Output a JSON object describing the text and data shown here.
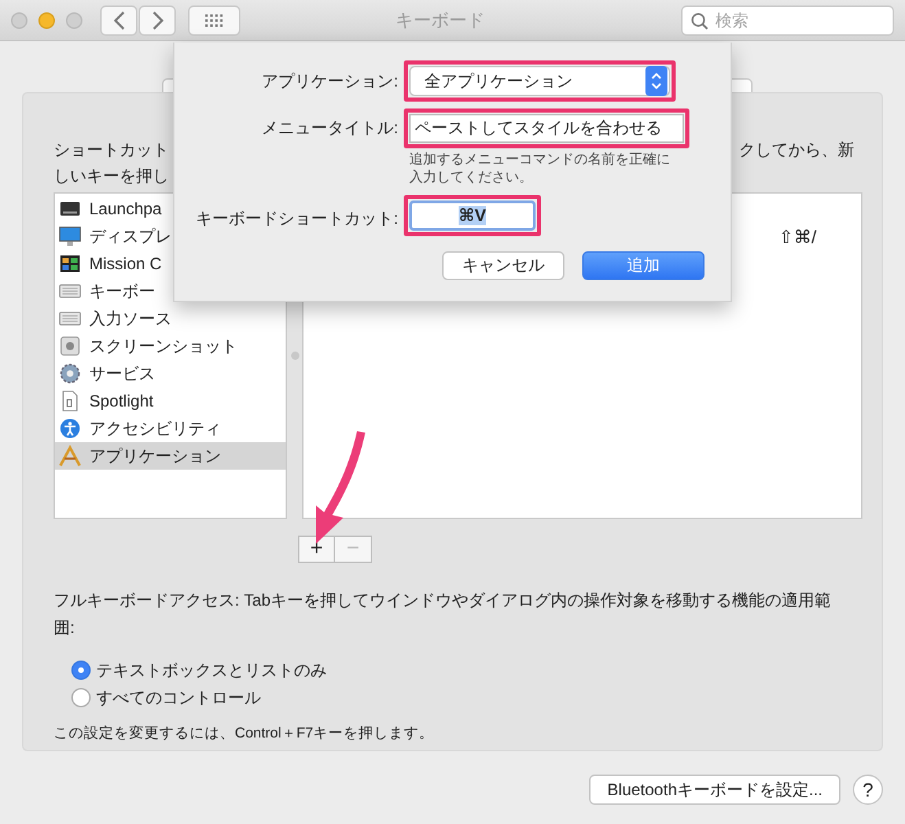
{
  "window": {
    "title": "キーボード"
  },
  "search": {
    "placeholder": "検索"
  },
  "shortcut_hint": [
    "ショートカット",
    "クしてから、新",
    "しいキーを押し"
  ],
  "categories": [
    {
      "label": "Launchpa",
      "kind": "launchpad",
      "selected": false
    },
    {
      "label": "ディスプレ",
      "kind": "display",
      "selected": false
    },
    {
      "label": "Mission C",
      "kind": "mission",
      "selected": false
    },
    {
      "label": "キーボー",
      "kind": "keyboard",
      "selected": false
    },
    {
      "label": "入力ソース",
      "kind": "keyboard",
      "selected": false
    },
    {
      "label": "スクリーンショット",
      "kind": "screenshot",
      "selected": false
    },
    {
      "label": "サービス",
      "kind": "gear",
      "selected": false
    },
    {
      "label": "Spotlight",
      "kind": "document",
      "selected": false
    },
    {
      "label": "アクセシビリティ",
      "kind": "accessibility",
      "selected": false
    },
    {
      "label": "アプリケーション",
      "kind": "apps",
      "selected": true
    }
  ],
  "shortcuts": [
    {
      "keys": "⇧⌘/"
    }
  ],
  "list_buttons": [
    {
      "label": "+",
      "disabled": false
    },
    {
      "label": "−",
      "disabled": true
    }
  ],
  "full_keyboard_access": {
    "text": "フルキーボードアクセス: Tabキーを押してウインドウやダイアログ内の操作対象を移動する機能の適用範囲:",
    "options": [
      {
        "label": "テキストボックスとリストのみ",
        "selected": true
      },
      {
        "label": "すべてのコントロール",
        "selected": false
      }
    ],
    "note": "この設定を変更するには、Control＋F7キーを押します。"
  },
  "footer_buttons": [
    {
      "label": "Bluetoothキーボードを設定...",
      "kind": "push"
    },
    {
      "label": "?",
      "kind": "help"
    }
  ],
  "sheet": {
    "fields": [
      {
        "label": "アプリケーション:",
        "kind": "popup",
        "value": "全アプリケーション",
        "highlighted": true
      },
      {
        "label": "メニュータイトル:",
        "kind": "text",
        "value": "ペーストしてスタイルを合わせる",
        "highlighted": true,
        "hint": "追加するメニューコマンドの名前を正確に入力してください。"
      },
      {
        "label": "キーボードショートカット:",
        "kind": "shortcut",
        "value": "⌘V",
        "highlighted": true
      }
    ],
    "buttons": [
      {
        "label": "キャンセル",
        "default": false
      },
      {
        "label": "追加",
        "default": true
      }
    ]
  }
}
